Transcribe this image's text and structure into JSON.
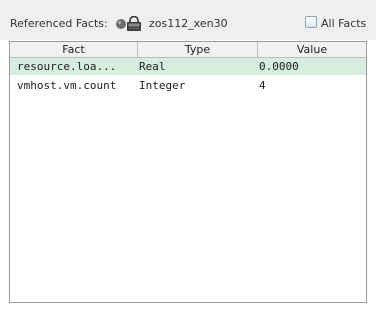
{
  "toolbar": {
    "referenced_label": "Referenced Facts:",
    "object_icon": "vm-host-icon",
    "object_name": "zos112_xen30",
    "all_facts_label": "All Facts",
    "all_facts_checked": false
  },
  "table": {
    "columns": [
      "Fact",
      "Type",
      "Value"
    ],
    "rows": [
      {
        "fact": "resource.loa...",
        "type": "Real",
        "value": "0.0000",
        "selected": true
      },
      {
        "fact": "vmhost.vm.count",
        "type": "Integer",
        "value": "4",
        "selected": false
      }
    ]
  }
}
